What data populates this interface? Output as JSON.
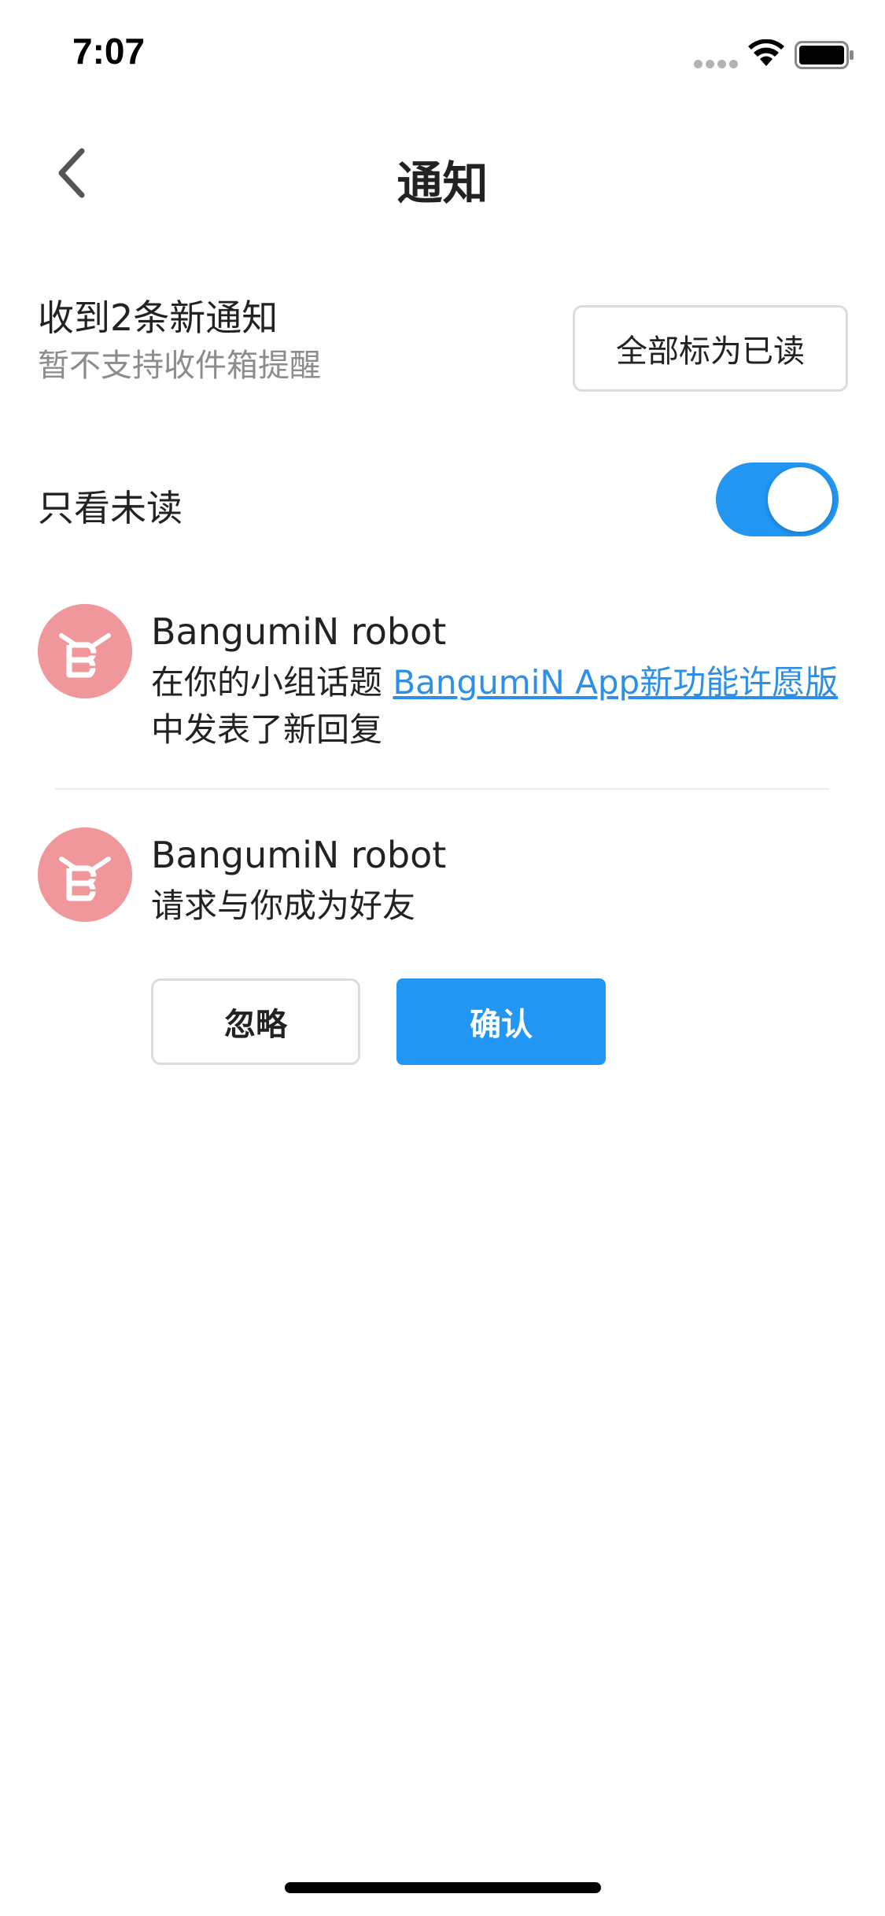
{
  "status_bar": {
    "time": "7:07"
  },
  "nav": {
    "title": "通知",
    "back_icon": "chevron-left-icon"
  },
  "summary": {
    "title": "收到2条新通知",
    "subtitle": "暂不支持收件箱提醒",
    "mark_all_label": "全部标为已读"
  },
  "filter": {
    "label": "只看未读",
    "enabled": true
  },
  "notifications": [
    {
      "sender": "BangumiN robot",
      "prefix": "在你的小组话题 ",
      "link": "BangumiN App新功能许愿版",
      "suffix": "中发表了新回复"
    },
    {
      "sender": "BangumiN robot",
      "text": "请求与你成为好友",
      "ignore_label": "忽略",
      "confirm_label": "确认"
    }
  ],
  "colors": {
    "accent": "#2196f3",
    "link": "#2e8fe6",
    "avatar": "#f0979c",
    "muted": "#8c8c8c"
  }
}
